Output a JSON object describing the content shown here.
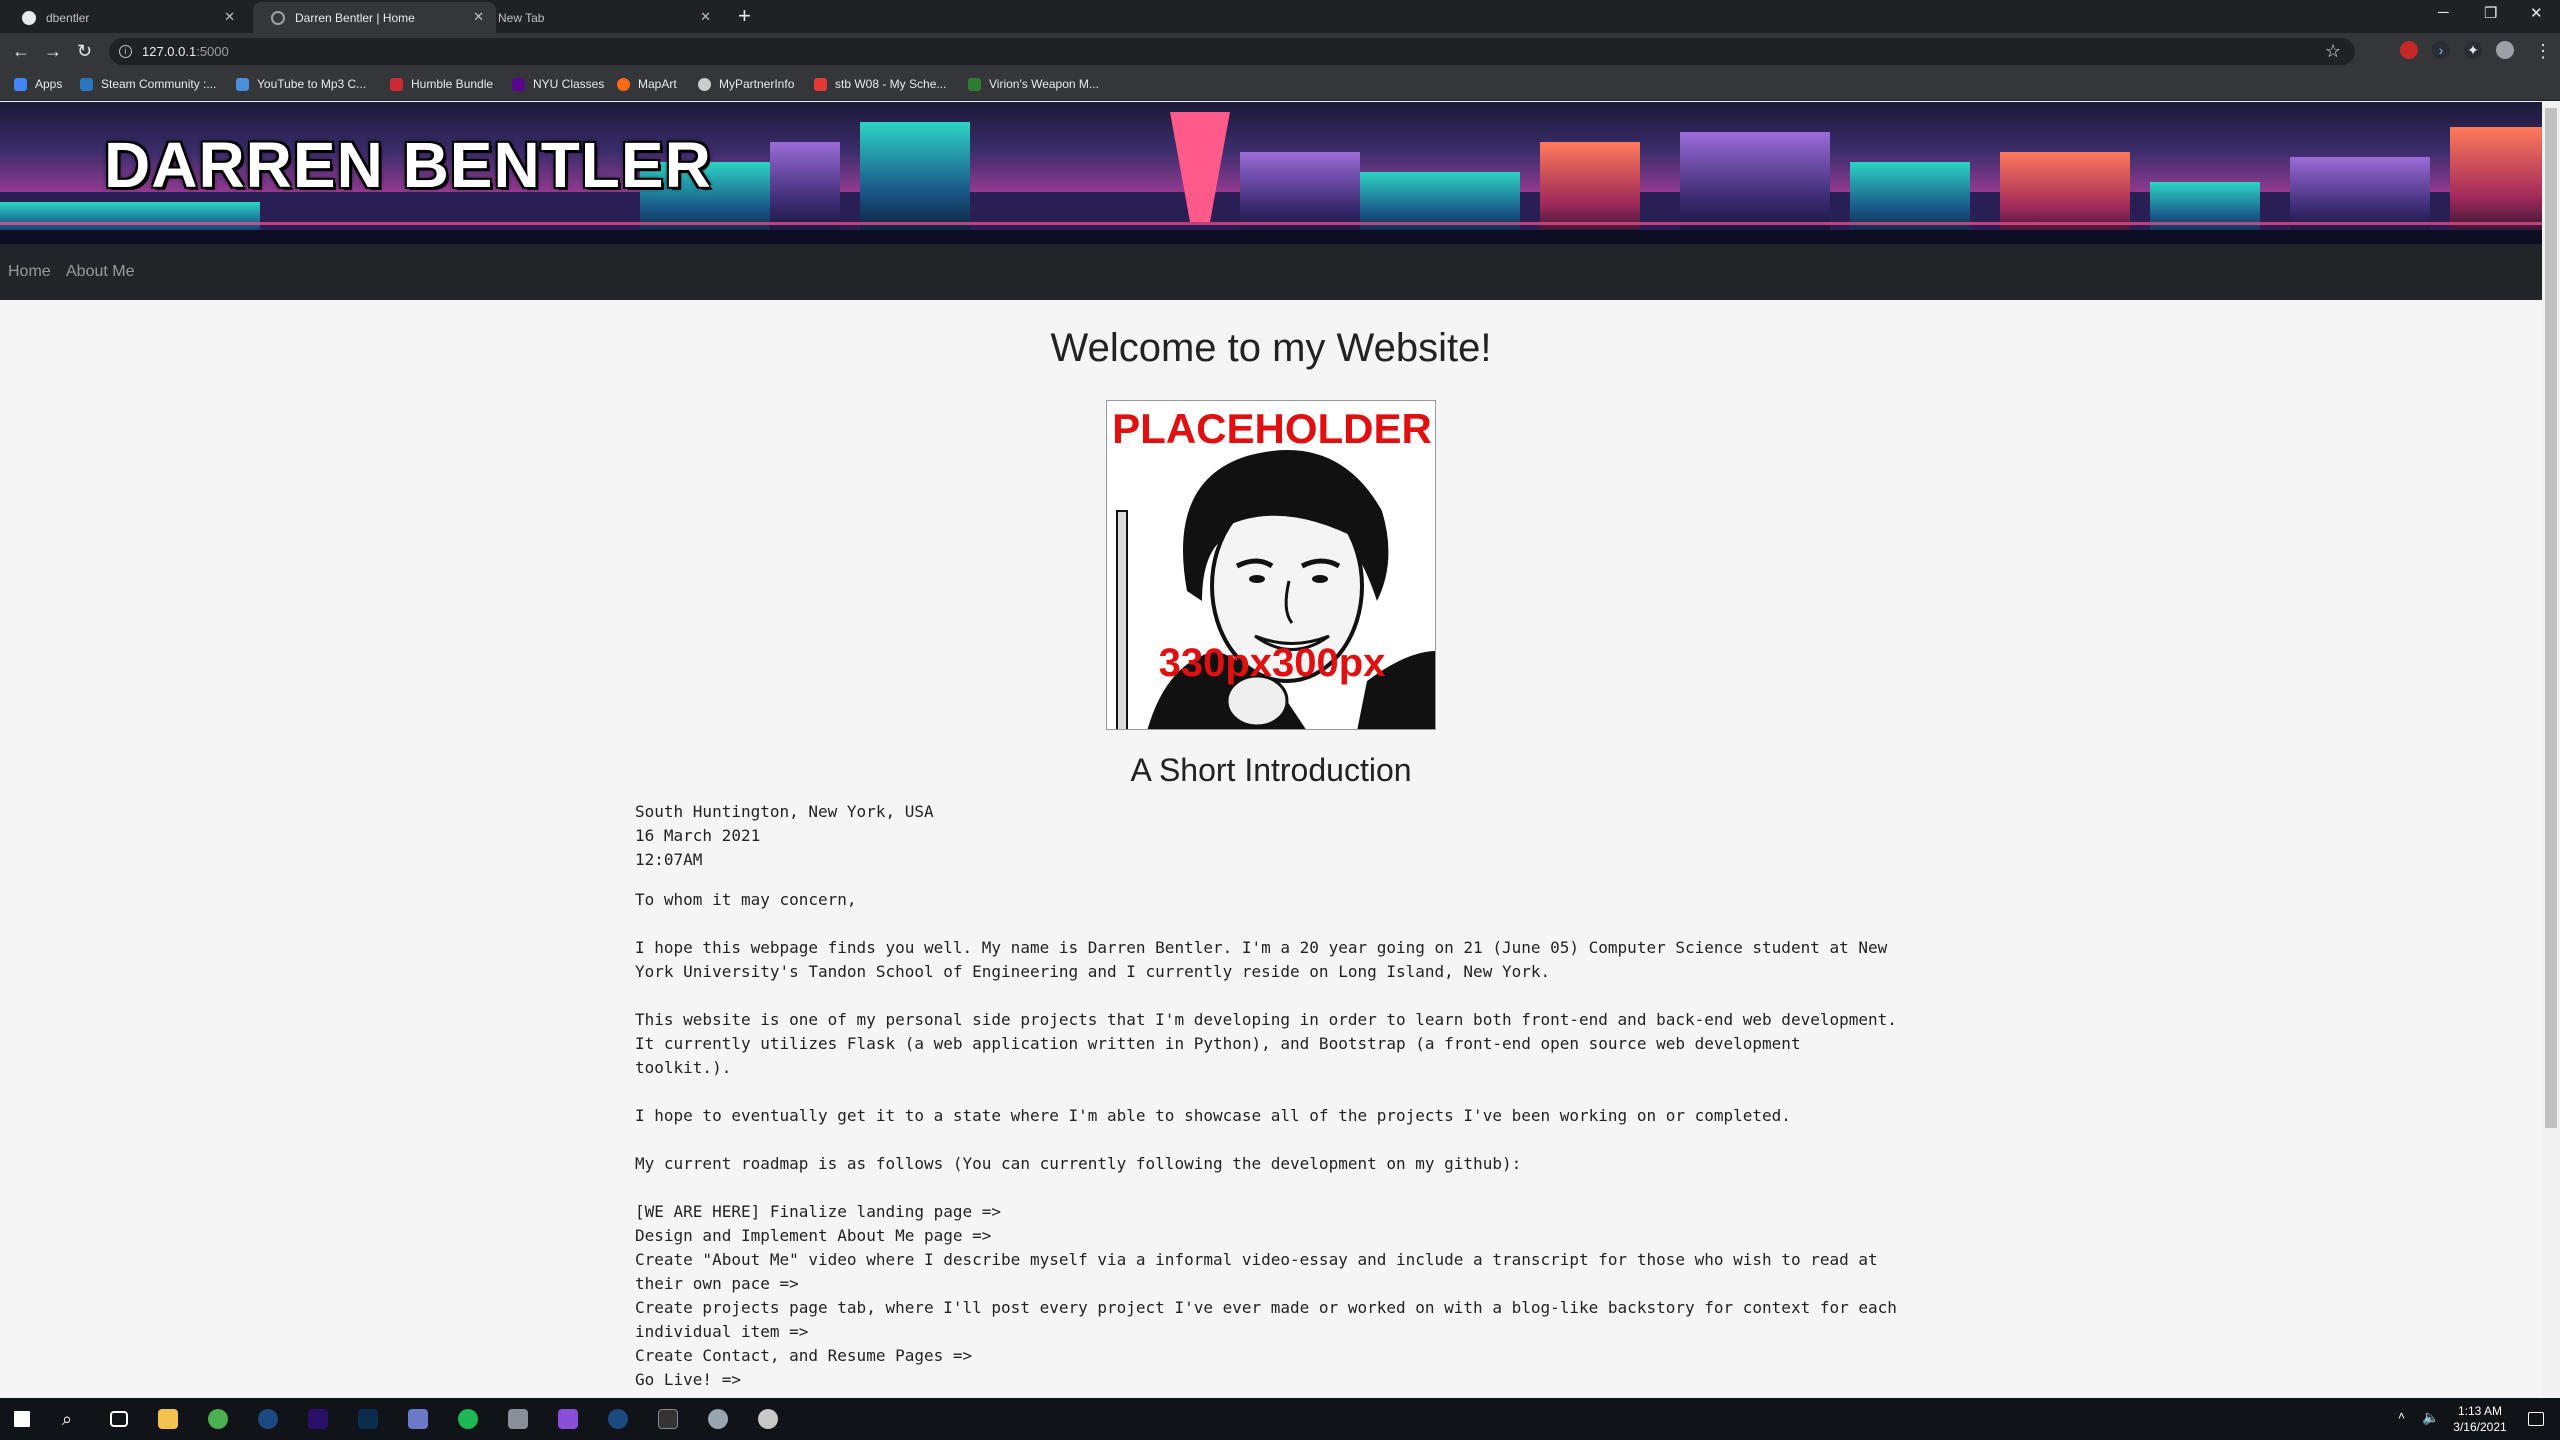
{
  "browser": {
    "tabs": [
      {
        "title": "dbentler",
        "active": false
      },
      {
        "title": "Darren Bentler | Home",
        "active": true
      },
      {
        "title": "New Tab",
        "active": false
      }
    ],
    "new_tab": "+",
    "url_host": "127.0.0.1",
    "url_port": ":5000",
    "bookmarks": [
      "Apps",
      "Steam Community :...",
      "YouTube to Mp3 C...",
      "Humble Bundle",
      "NYU Classes",
      "MapArt",
      "MyPartnerInfo",
      "stb W08 - My Sche...",
      "Virion's Weapon M..."
    ],
    "bookmark_colors": [
      "#4285f4",
      "#2a75bb",
      "#4a90d9",
      "#cc2936",
      "#57068c",
      "#ff6a13",
      "#cccccc",
      "#e53935",
      "#2e7d32"
    ]
  },
  "site": {
    "title": "DARREN BENTLER",
    "nav": [
      "Home",
      "About Me"
    ],
    "welcome": "Welcome to my Website!",
    "photo": {
      "top_text": "PLACEHOLDER",
      "bottom_text": "330px300px"
    },
    "intro_title": "A Short Introduction",
    "letter": {
      "location": "South Huntington, New York, USA",
      "date": "16 March 2021",
      "time": "12:07AM",
      "greeting": "To whom it may concern,",
      "p1": "I hope this webpage finds you well. My name is Darren Bentler. I'm a 20 year going on 21 (June 05) Computer Science student at New York University's Tandon School of Engineering and I currently reside on Long Island, New York.",
      "p2": "This website is one of my personal side projects that I'm developing in order to learn both front-end and back-end web development. It currently utilizes Flask (a web application written in Python), and Bootstrap (a front-end open source web development toolkit.).",
      "p3": "I hope to eventually get it to a state where I'm able to showcase all of the projects I've been working on or completed.",
      "p4": "My current roadmap is as follows (You can currently following the development on my github):",
      "roadmap": [
        "[WE ARE HERE] Finalize landing page =>",
        "Design and Implement About Me page =>",
        "Create \"About Me\" video where I describe myself via a informal video-essay and include a transcript for those who wish to read at their own pace =>",
        "Create projects page tab, where I'll post every project I've ever made or worked on with a blog-like backstory for context for each individual item =>",
        "Create Contact, and Resume Pages =>",
        "Go Live! =>"
      ]
    }
  },
  "taskbar": {
    "time": "1:13 AM",
    "date": "3/16/2021"
  }
}
